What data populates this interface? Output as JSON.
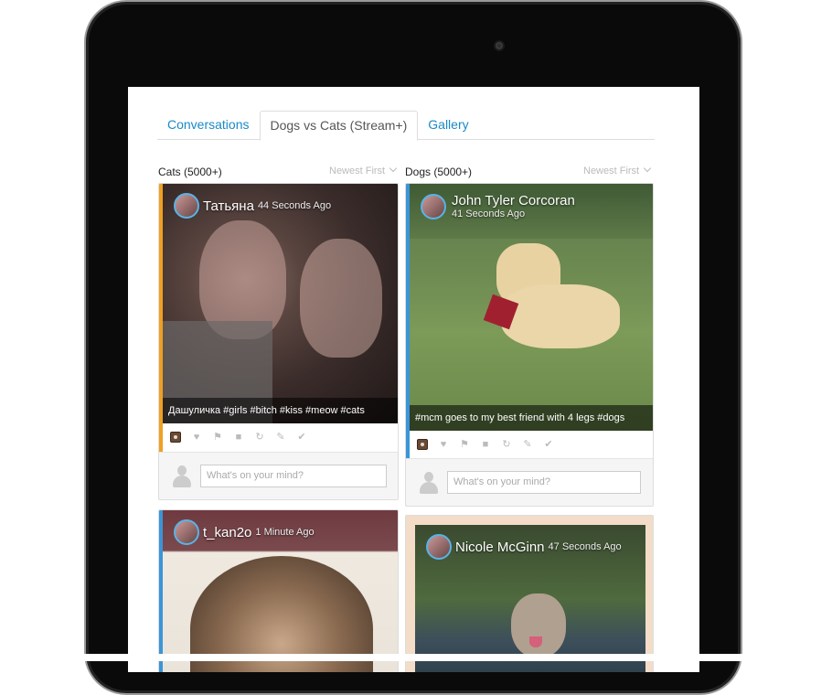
{
  "tabs": [
    {
      "label": "Conversations",
      "active": false
    },
    {
      "label": "Dogs vs Cats (Stream+)",
      "active": true
    },
    {
      "label": "Gallery",
      "active": false
    }
  ],
  "columns": [
    {
      "title": "Cats (5000+)",
      "sort": "Newest First"
    },
    {
      "title": "Dogs (5000+)",
      "sort": "Newest First"
    }
  ],
  "posts": {
    "cats_1": {
      "user": "Татьяна",
      "time": "44 Seconds Ago",
      "caption": "Дашуличка #girls #bitch #kiss #meow #cats",
      "accent": "#f0a020",
      "comment_placeholder": "What's on your mind?"
    },
    "cats_2": {
      "user": "t_kan2o",
      "time": "1 Minute Ago",
      "accent": "#3a95d8"
    },
    "dogs_1": {
      "user": "John Tyler Corcoran",
      "time": "41 Seconds Ago",
      "caption": "#mcm goes to my best friend with 4 legs #dogs",
      "accent": "#3a95d8",
      "comment_placeholder": "What's on your mind?"
    },
    "dogs_2": {
      "user": "Nicole McGinn",
      "time": "47 Seconds Ago",
      "accent": "#f3dcc8"
    }
  },
  "icons": [
    "instagram-icon",
    "heart-icon",
    "flag-icon",
    "comment-icon",
    "share-icon",
    "edit-icon",
    "check-icon",
    "user-icon",
    "chevron-down-icon"
  ]
}
